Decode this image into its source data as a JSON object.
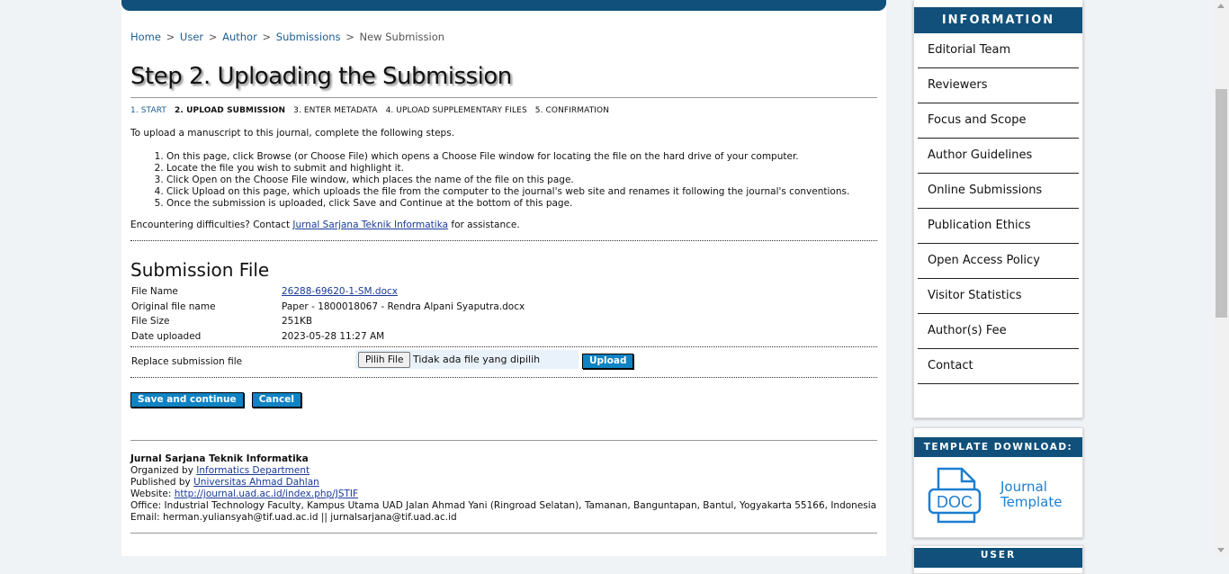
{
  "breadcrumb": {
    "items": [
      "Home",
      "User",
      "Author",
      "Submissions"
    ],
    "current": "New Submission",
    "separator": ">"
  },
  "page_title": "Step 2. Uploading the Submission",
  "steps": [
    {
      "label": "1. START",
      "state": "link"
    },
    {
      "label": "2. UPLOAD SUBMISSION",
      "state": "current"
    },
    {
      "label": "3. ENTER METADATA",
      "state": "plain"
    },
    {
      "label": "4. UPLOAD SUPPLEMENTARY FILES",
      "state": "plain"
    },
    {
      "label": "5. CONFIRMATION",
      "state": "plain"
    }
  ],
  "intro": "To upload a manuscript to this journal, complete the following steps.",
  "instructions": [
    "On this page, click Browse (or Choose File) which opens a Choose File window for locating the file on the hard drive of your computer.",
    "Locate the file you wish to submit and highlight it.",
    "Click Open on the Choose File window, which places the name of the file on this page.",
    "Click Upload on this page, which uploads the file from the computer to the journal's web site and renames it following the journal's conventions.",
    "Once the submission is uploaded, click Save and Continue at the bottom of this page."
  ],
  "contact": {
    "prefix": "Encountering difficulties? Contact",
    "link": "Jurnal Sarjana Teknik Informatika",
    "suffix": "for assistance."
  },
  "submission_file": {
    "heading": "Submission File",
    "rows": [
      {
        "label": "File Name",
        "value": "26288-69620-1-SM.docx",
        "link": true
      },
      {
        "label": "Original file name",
        "value": "Paper - 1800018067 - Rendra Alpani Syaputra.docx",
        "link": false
      },
      {
        "label": "File Size",
        "value": "251KB",
        "link": false
      },
      {
        "label": "Date uploaded",
        "value": "2023-05-28 11:27 AM",
        "link": false
      }
    ],
    "replace_label": "Replace submission file",
    "choose_button": "Pilih File",
    "no_file_text": "Tidak ada file yang dipilih",
    "upload_button": "Upload"
  },
  "actions": {
    "save": "Save and continue",
    "cancel": "Cancel"
  },
  "footer": {
    "journal": "Jurnal Sarjana Teknik Informatika",
    "organized_prefix": "Organized by",
    "organized_link": "Informatics Department",
    "published_prefix": "Published by",
    "published_link": "Universitas Ahmad Dahlan",
    "website_prefix": "Website:",
    "website_link": "http://journal.uad.ac.id/index.php/JSTIF",
    "office": "Office: Industrial Technology Faculty, Kampus Utama UAD Jalan Ahmad Yani (Ringroad Selatan), Tamanan, Banguntapan, Bantul, Yogyakarta 55166, Indonesia",
    "email": "Email: herman.yuliansyah@tif.uad.ac.id || jurnalsarjana@tif.uad.ac.id"
  },
  "sidebar": {
    "info_title": "INFORMATION",
    "menu": [
      "Editorial Team",
      "Reviewers",
      "Focus and Scope",
      "Author Guidelines",
      "Online Submissions",
      "Publication Ethics",
      "Open Access Policy",
      "Visitor Statistics",
      "Author(s) Fee",
      "Contact"
    ],
    "template_title": "TEMPLATE DOWNLOAD:",
    "template_line1": "Journal",
    "template_line2": "Template",
    "doc_badge": "DOC",
    "user_title": "USER"
  },
  "colors": {
    "header": "#10507a",
    "button": "#0f83c4",
    "template_text": "#1c7fd1"
  }
}
